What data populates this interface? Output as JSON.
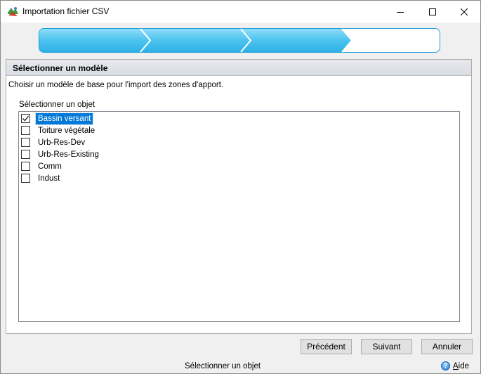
{
  "window": {
    "title": "Importation fichier CSV"
  },
  "progress": {
    "steps_total": 4,
    "steps_completed": 3
  },
  "panel": {
    "header": "Sélectionner un modèle",
    "description": "Choisir un modèle de base pour l'import des zones d'apport.",
    "list_label": "Sélectionner un objet",
    "items": [
      {
        "label": "Bassin versant",
        "checked": true,
        "selected": true
      },
      {
        "label": "Toiture végétale",
        "checked": false,
        "selected": false
      },
      {
        "label": "Urb-Res-Dev",
        "checked": false,
        "selected": false
      },
      {
        "label": "Urb-Res-Existing",
        "checked": false,
        "selected": false
      },
      {
        "label": "Comm",
        "checked": false,
        "selected": false
      },
      {
        "label": "Indust",
        "checked": false,
        "selected": false
      }
    ]
  },
  "buttons": {
    "previous": "Précédent",
    "next": "Suivant",
    "cancel": "Annuler"
  },
  "statusbar": {
    "text": "Sélectionner un objet",
    "help_first": "A",
    "help_rest": "ide"
  },
  "colors": {
    "progress_fill": "#4cc3ef",
    "progress_border": "#1e9fd8",
    "selection": "#0078d7"
  },
  "icons": {
    "app": "csv-import-app-icon",
    "help": "help-icon"
  }
}
